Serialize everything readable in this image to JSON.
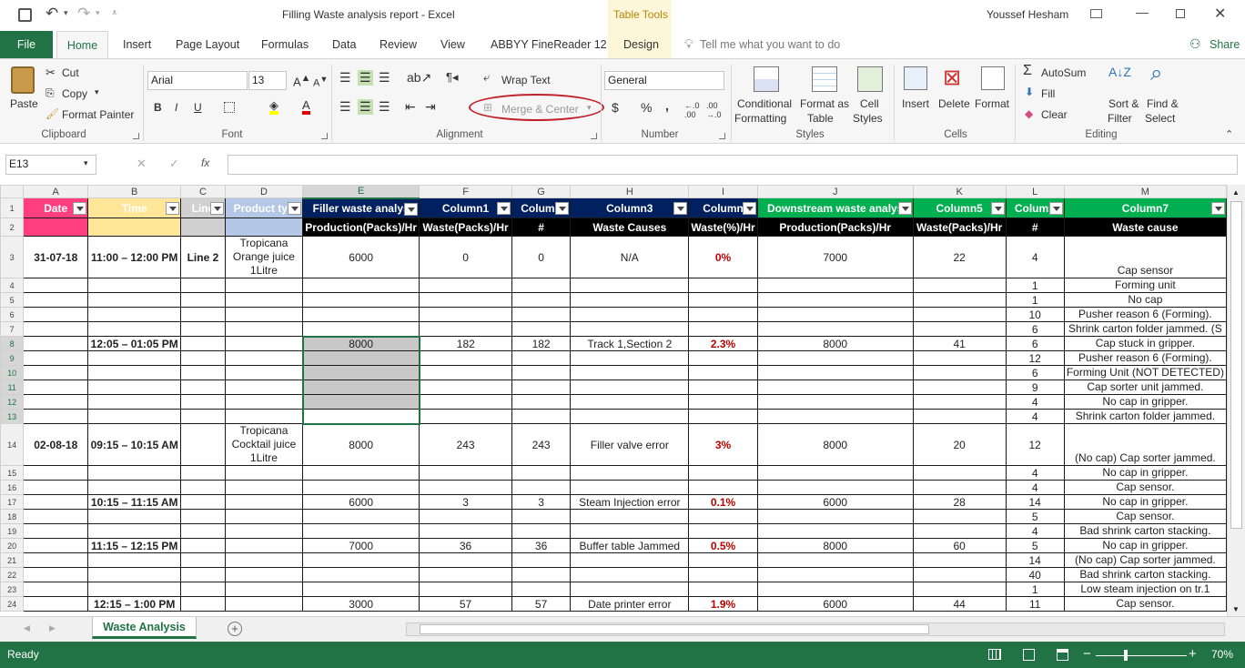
{
  "window": {
    "title": "Filling Waste analysis report  -  Excel",
    "table_tools": "Table Tools",
    "user": "Youssef Hesham"
  },
  "tabs": [
    "File",
    "Home",
    "Insert",
    "Page Layout",
    "Formulas",
    "Data",
    "Review",
    "View",
    "ABBYY FineReader 12",
    "Design"
  ],
  "tell_me": "Tell me what you want to do",
  "share": "Share",
  "ribbon": {
    "paste": "Paste",
    "cut": "Cut",
    "copy": "Copy",
    "format_painter": "Format Painter",
    "clipboard": "Clipboard",
    "font_name": "Arial",
    "font_size": "13",
    "bold": "B",
    "italic": "I",
    "underline": "U",
    "font_group": "Font",
    "wrap_text": "Wrap Text",
    "merge_center": "Merge & Center",
    "alignment": "Alignment",
    "number_format": "General",
    "currency": "$",
    "percent": "%",
    "comma": ",",
    "number": "Number",
    "conditional_formatting": [
      "Conditional",
      "Formatting"
    ],
    "format_as_table": [
      "Format as",
      "Table"
    ],
    "cell_styles": [
      "Cell",
      "Styles"
    ],
    "styles": "Styles",
    "insert": "Insert",
    "delete": "Delete",
    "format": "Format",
    "cells": "Cells",
    "autosum": "AutoSum",
    "fill": "Fill",
    "clear": "Clear",
    "sort_filter": [
      "Sort &",
      "Filter"
    ],
    "find_select": [
      "Find &",
      "Select"
    ],
    "editing": "Editing",
    "accent_color": "#217346",
    "highlight_ellipse_color": "#c0202a"
  },
  "formula_bar": {
    "name_box": "E13",
    "fx": "fx",
    "formula": ""
  },
  "columns": [
    "A",
    "B",
    "C",
    "D",
    "E",
    "F",
    "G",
    "H",
    "I",
    "J",
    "K",
    "L",
    "M"
  ],
  "header_row1": [
    {
      "text": "Date",
      "bg": "#ff3f7f"
    },
    {
      "text": "Time",
      "bg": "#ffe699"
    },
    {
      "text": "Line",
      "bg": "#d0d0d0"
    },
    {
      "text": "Product typ",
      "bg": "#b4c7e7"
    },
    {
      "text": "Filler waste analys",
      "bg": "#002060"
    },
    {
      "text": "Column1",
      "bg": "#002060"
    },
    {
      "text": "Column",
      "bg": "#002060"
    },
    {
      "text": "Column3",
      "bg": "#002060"
    },
    {
      "text": "Column",
      "bg": "#002060"
    },
    {
      "text": "Downstream waste analys",
      "bg": "#00b050"
    },
    {
      "text": "Column5",
      "bg": "#00b050"
    },
    {
      "text": "Column",
      "bg": "#00b050"
    },
    {
      "text": "Column7",
      "bg": "#00b050"
    }
  ],
  "header_row2": [
    "",
    "",
    "",
    "",
    "Production(Packs)/Hr",
    "Waste(Packs)/Hr",
    "#",
    "Waste Causes",
    "Waste(%)/Hr",
    "Production(Packs)/Hr",
    "Waste(Packs)/Hr",
    "#",
    "Waste cause"
  ],
  "rows": [
    {
      "n": "3",
      "cells": [
        "31-07-18",
        "11:00 – 12:00 PM",
        "Line 2",
        "Tropicana\nOrange juice\n1Litre",
        "6000",
        "0",
        "0",
        "N/A",
        "0%",
        "7000",
        "22",
        "4",
        "\nCap sensor"
      ]
    },
    {
      "n": "4",
      "cells": [
        "",
        "",
        "",
        "",
        "",
        "",
        "",
        "",
        "",
        "",
        "",
        "1",
        "Forming unit"
      ]
    },
    {
      "n": "5",
      "cells": [
        "",
        "",
        "",
        "",
        "",
        "",
        "",
        "",
        "",
        "",
        "",
        "1",
        "No cap"
      ]
    },
    {
      "n": "6",
      "cells": [
        "",
        "",
        "",
        "",
        "",
        "",
        "",
        "",
        "",
        "",
        "",
        "10",
        "Pusher reason 6 (Forming)."
      ]
    },
    {
      "n": "7",
      "cells": [
        "",
        "",
        "",
        "",
        "",
        "",
        "",
        "",
        "",
        "",
        "",
        "6",
        "Shrink carton folder jammed. (S"
      ]
    },
    {
      "n": "8",
      "cells": [
        "",
        "12:05 – 01:05 PM",
        "",
        "",
        "8000",
        "182",
        "182",
        "Track 1,Section 2",
        "2.3%",
        "8000",
        "41",
        "6",
        "Cap stuck in gripper."
      ]
    },
    {
      "n": "9",
      "cells": [
        "",
        "",
        "",
        "",
        "",
        "",
        "",
        "",
        "",
        "",
        "",
        "12",
        "Pusher reason 6 (Forming)."
      ]
    },
    {
      "n": "10",
      "cells": [
        "",
        "",
        "",
        "",
        "",
        "",
        "",
        "",
        "",
        "",
        "",
        "6",
        "Forming Unit (NOT DETECTED)"
      ]
    },
    {
      "n": "11",
      "cells": [
        "",
        "",
        "",
        "",
        "",
        "",
        "",
        "",
        "",
        "",
        "",
        "9",
        "Cap sorter unit jammed."
      ]
    },
    {
      "n": "12",
      "cells": [
        "",
        "",
        "",
        "",
        "",
        "",
        "",
        "",
        "",
        "",
        "",
        "4",
        "No cap in gripper."
      ]
    },
    {
      "n": "13",
      "cells": [
        "",
        "",
        "",
        "",
        "",
        "",
        "",
        "",
        "",
        "",
        "",
        "4",
        "Shrink carton folder jammed."
      ]
    },
    {
      "n": "14",
      "cells": [
        "02-08-18",
        "09:15 – 10:15 AM",
        "",
        "Tropicana\nCocktail juice\n1Litre",
        "8000",
        "243",
        "243",
        "Filler valve error",
        "3%",
        "8000",
        "20",
        "12",
        "\n(No cap) Cap sorter jammed."
      ]
    },
    {
      "n": "15",
      "cells": [
        "",
        "",
        "",
        "",
        "",
        "",
        "",
        "",
        "",
        "",
        "",
        "4",
        "No cap in gripper."
      ]
    },
    {
      "n": "16",
      "cells": [
        "",
        "",
        "",
        "",
        "",
        "",
        "",
        "",
        "",
        "",
        "",
        "4",
        "Cap sensor."
      ]
    },
    {
      "n": "17",
      "cells": [
        "",
        "10:15 – 11:15 AM",
        "",
        "",
        "6000",
        "3",
        "3",
        "Steam Injection error",
        "0.1%",
        "6000",
        "28",
        "14",
        "No cap in gripper."
      ]
    },
    {
      "n": "18",
      "cells": [
        "",
        "",
        "",
        "",
        "",
        "",
        "",
        "",
        "",
        "",
        "",
        "5",
        "Cap sensor."
      ]
    },
    {
      "n": "19",
      "cells": [
        "",
        "",
        "",
        "",
        "",
        "",
        "",
        "",
        "",
        "",
        "",
        "4",
        "Bad shrink carton stacking."
      ]
    },
    {
      "n": "20",
      "cells": [
        "",
        "11:15 – 12:15 PM",
        "",
        "",
        "7000",
        "36",
        "36",
        "Buffer table Jammed",
        "0.5%",
        "8000",
        "60",
        "5",
        "No cap in gripper."
      ]
    },
    {
      "n": "21",
      "cells": [
        "",
        "",
        "",
        "",
        "",
        "",
        "",
        "",
        "",
        "",
        "",
        "14",
        "(No cap) Cap sorter jammed."
      ]
    },
    {
      "n": "22",
      "cells": [
        "",
        "",
        "",
        "",
        "",
        "",
        "",
        "",
        "",
        "",
        "",
        "40",
        "Bad shrink carton stacking."
      ]
    },
    {
      "n": "23",
      "cells": [
        "",
        "",
        "",
        "",
        "",
        "",
        "",
        "",
        "",
        "",
        "",
        "1",
        "Low steam injection on tr.1"
      ]
    },
    {
      "n": "24",
      "cells": [
        "",
        "12:15 – 1:00 PM",
        "",
        "",
        "3000",
        "57",
        "57",
        "Date printer error",
        "1.9%",
        "6000",
        "44",
        "11",
        "Cap sensor."
      ]
    }
  ],
  "sheet_tab": "Waste Analysis",
  "status": {
    "ready": "Ready",
    "zoom": "70%"
  }
}
